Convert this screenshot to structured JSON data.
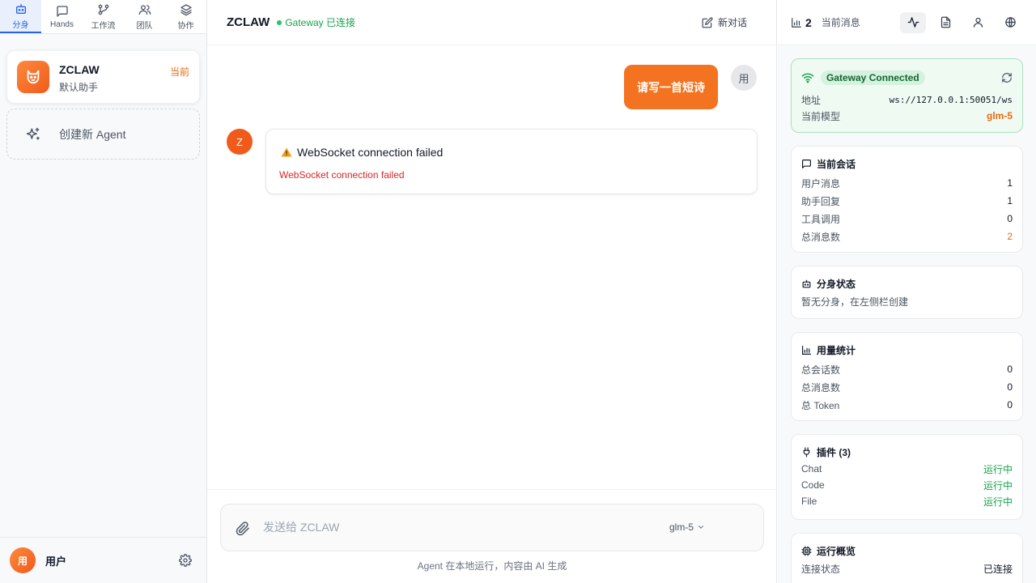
{
  "sidebar": {
    "tabs": [
      {
        "label": "分身",
        "icon": "robot-icon"
      },
      {
        "label": "Hands",
        "icon": "message-square-icon"
      },
      {
        "label": "工作流",
        "icon": "git-branch-icon"
      },
      {
        "label": "团队",
        "icon": "users-icon"
      },
      {
        "label": "协作",
        "icon": "layers-icon"
      }
    ],
    "agent": {
      "name": "ZCLAW",
      "subtitle": "默认助手",
      "badge": "当前"
    },
    "create_label": "创建新 Agent",
    "user": {
      "avatar_text": "用",
      "name": "用户"
    }
  },
  "main": {
    "title": "ZCLAW",
    "gateway_status": "Gateway 已连接",
    "new_chat_label": "新对话",
    "messages": [
      {
        "role": "user",
        "text": "请写一首短诗",
        "avatar": "用"
      },
      {
        "role": "assistant",
        "avatar": "Z",
        "error_title": "WebSocket connection failed",
        "error_detail": "WebSocket connection failed"
      }
    ],
    "composer": {
      "placeholder": "发送给 ZCLAW",
      "model": "glm-5"
    },
    "disclaimer": "Agent 在本地运行，内容由 AI 生成"
  },
  "right": {
    "header": {
      "count": "2",
      "label": "当前消息"
    },
    "gateway": {
      "badge": "Gateway Connected",
      "address_label": "地址",
      "address": "ws://127.0.0.1:50051/ws",
      "model_label": "当前模型",
      "model": "glm-5"
    },
    "session": {
      "title": "当前会话",
      "rows": [
        {
          "label": "用户消息",
          "value": "1"
        },
        {
          "label": "助手回复",
          "value": "1"
        },
        {
          "label": "工具调用",
          "value": "0"
        },
        {
          "label": "总消息数",
          "value": "2"
        }
      ]
    },
    "clones": {
      "title": "分身状态",
      "empty": "暂无分身，在左侧栏创建"
    },
    "usage": {
      "title": "用量统计",
      "rows": [
        {
          "label": "总会话数",
          "value": "0"
        },
        {
          "label": "总消息数",
          "value": "0"
        },
        {
          "label": "总 Token",
          "value": "0"
        }
      ]
    },
    "plugins": {
      "title": "插件 (3)",
      "rows": [
        {
          "label": "Chat",
          "value": "运行中"
        },
        {
          "label": "Code",
          "value": "运行中"
        },
        {
          "label": "File",
          "value": "运行中"
        }
      ]
    },
    "overview": {
      "title": "运行概览",
      "rows": [
        {
          "label": "连接状态",
          "value": "已连接"
        }
      ]
    }
  },
  "colors": {
    "accent": "#f47320",
    "primary": "#2563eb",
    "success": "#16a34a",
    "error": "#dc2626"
  }
}
